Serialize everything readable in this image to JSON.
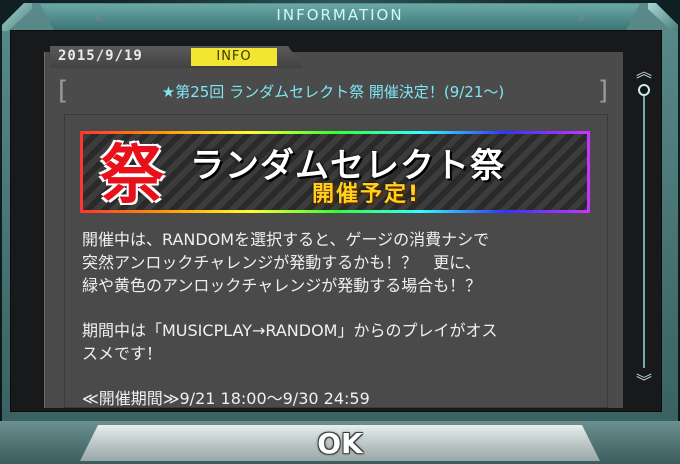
{
  "window": {
    "title": "INFORMATION"
  },
  "article": {
    "date": "2015/9/19",
    "badge": "INFO",
    "bracket_left": "[",
    "bracket_right": "]",
    "headline": "★第25回 ランダムセレクト祭 開催決定！(9/21～)"
  },
  "banner": {
    "kanji": "祭",
    "title": "ランダムセレクト祭",
    "subtitle": "開催予定!"
  },
  "body": {
    "paragraph1": "開催中は、RANDOMを選択すると、ゲージの消費ナシで\n突然アンロックチャレンジが発動するかも！？　更に、\n緑や黄色のアンロックチャレンジが発動する場合も！？",
    "paragraph2": "期間中は「MUSICPLAY→RANDOM」からのプレイがオス\nスメです！",
    "paragraph3": "≪開催期間≫9/21 18:00～9/30 24:59"
  },
  "scrollbar": {
    "up_icon": "double-chevron-up",
    "down_icon": "double-chevron-down"
  },
  "footer": {
    "ok_label": "OK",
    "arrow_left": "«",
    "arrow_right": "»"
  },
  "colors": {
    "accent_teal": "#6aa8a8",
    "headline": "#7fe6f2",
    "badge": "#f2e632",
    "kanji_red": "#e8101a",
    "subtitle_gold": "#ffd21e"
  }
}
